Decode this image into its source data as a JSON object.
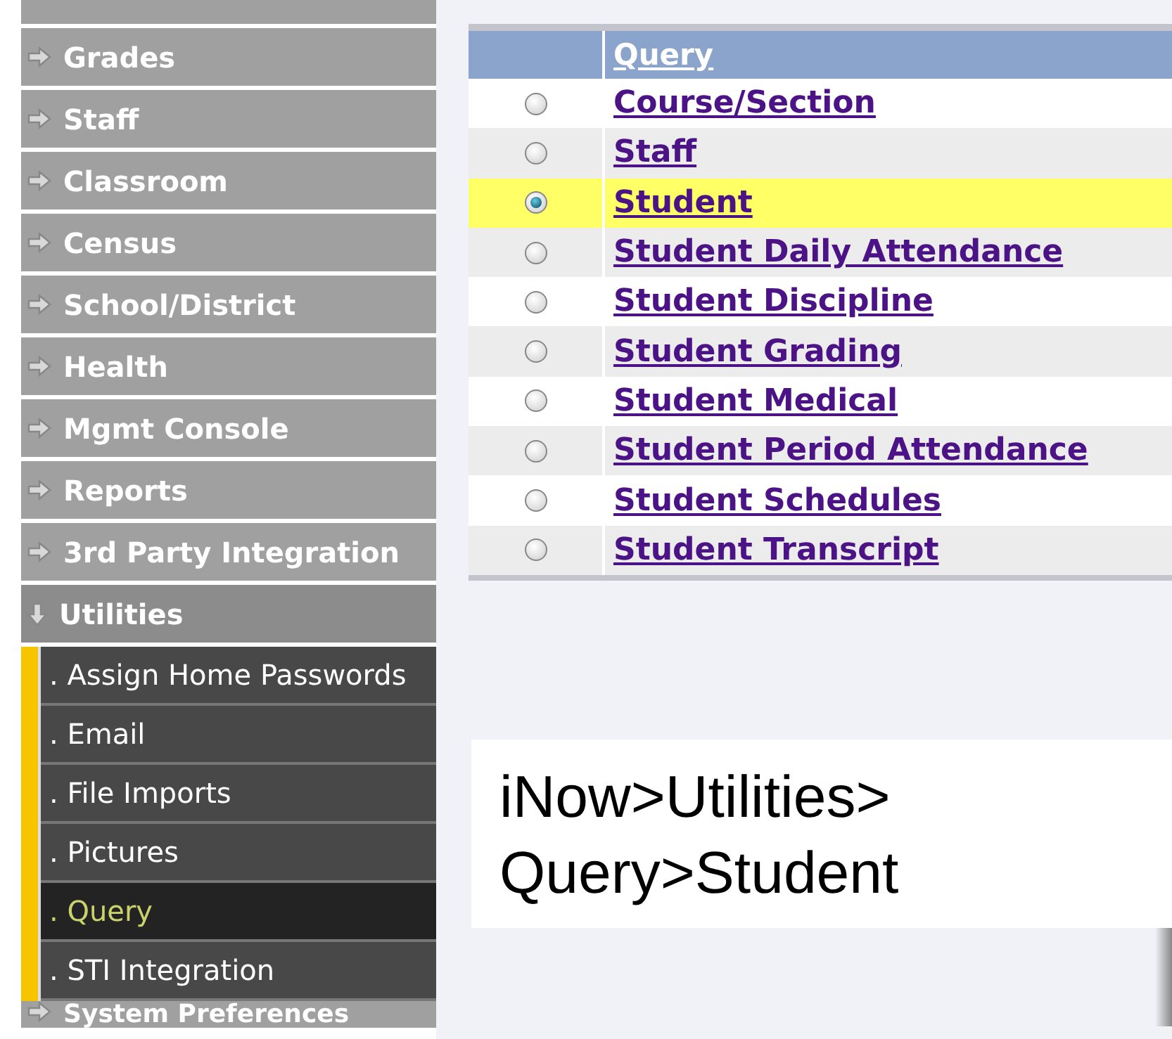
{
  "sidebar": {
    "items": [
      {
        "expanded": false
      },
      {
        "label": "Grades",
        "expanded": false
      },
      {
        "label": "Staff",
        "expanded": false
      },
      {
        "label": "Classroom",
        "expanded": false
      },
      {
        "label": "Census",
        "expanded": false
      },
      {
        "label": "School/District",
        "expanded": false
      },
      {
        "label": "Health",
        "expanded": false
      },
      {
        "label": "Mgmt Console",
        "expanded": false
      },
      {
        "label": "Reports",
        "expanded": false
      },
      {
        "label": "3rd Party Integration",
        "expanded": false
      },
      {
        "label": "Utilities",
        "expanded": true,
        "children": [
          {
            "label": ". Assign Home Passwords",
            "selected": false
          },
          {
            "label": ". Email",
            "selected": false
          },
          {
            "label": ". File Imports",
            "selected": false
          },
          {
            "label": ". Pictures",
            "selected": false
          },
          {
            "label": ". Query",
            "selected": true
          },
          {
            "label": ". STI Integration",
            "selected": false
          }
        ]
      },
      {
        "label": "System Preferences",
        "expanded": false
      }
    ]
  },
  "table": {
    "columns": [
      "",
      "Query"
    ],
    "rows": [
      {
        "label": "Course/Section",
        "selected": false
      },
      {
        "label": "Staff",
        "selected": false
      },
      {
        "label": "Student",
        "selected": true
      },
      {
        "label": "Student Daily Attendance",
        "selected": false
      },
      {
        "label": "Student Discipline",
        "selected": false
      },
      {
        "label": "Student Grading",
        "selected": false
      },
      {
        "label": "Student Medical",
        "selected": false
      },
      {
        "label": "Student Period Attendance",
        "selected": false
      },
      {
        "label": "Student Schedules",
        "selected": false
      },
      {
        "label": "Student Transcript",
        "selected": false
      }
    ]
  },
  "caption": [
    "iNow>Utilities>",
    "Query>Student"
  ]
}
